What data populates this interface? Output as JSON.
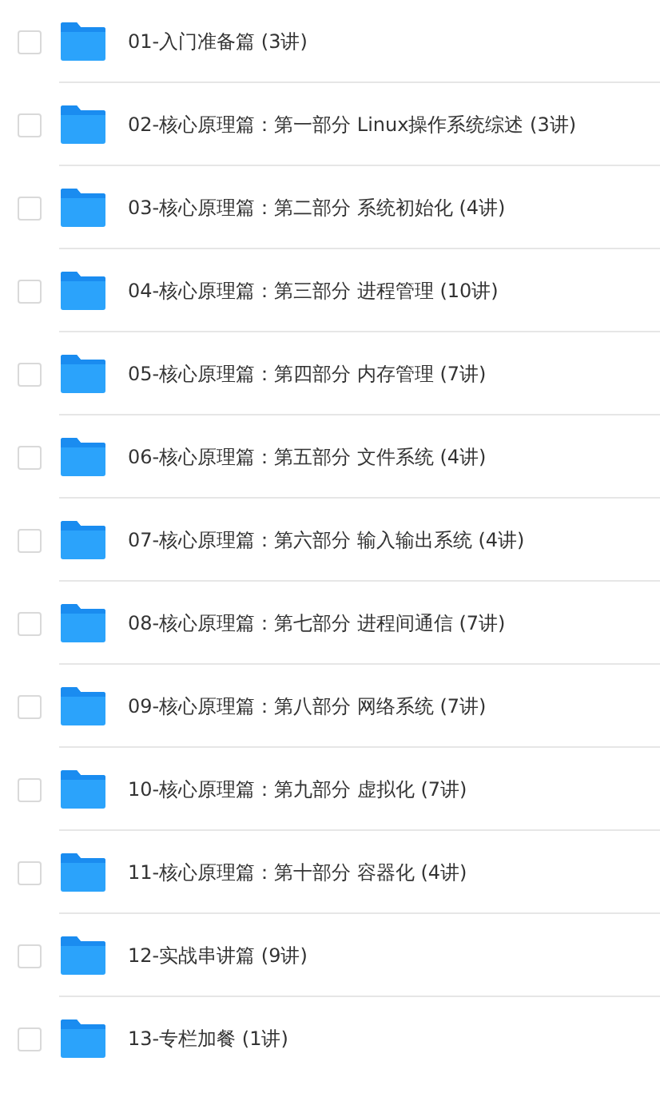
{
  "items": [
    {
      "title": "01-入门准备篇 (3讲)",
      "checked": false
    },
    {
      "title": "02-核心原理篇：第一部分 Linux操作系统综述 (3讲)",
      "checked": false
    },
    {
      "title": "03-核心原理篇：第二部分 系统初始化 (4讲)",
      "checked": false
    },
    {
      "title": "04-核心原理篇：第三部分 进程管理 (10讲)",
      "checked": false
    },
    {
      "title": "05-核心原理篇：第四部分 内存管理 (7讲)",
      "checked": false
    },
    {
      "title": "06-核心原理篇：第五部分 文件系统 (4讲)",
      "checked": false
    },
    {
      "title": "07-核心原理篇：第六部分 输入输出系统 (4讲)",
      "checked": false
    },
    {
      "title": "08-核心原理篇：第七部分 进程间通信 (7讲)",
      "checked": false
    },
    {
      "title": "09-核心原理篇：第八部分 网络系统 (7讲)",
      "checked": false
    },
    {
      "title": "10-核心原理篇：第九部分 虚拟化 (7讲)",
      "checked": false
    },
    {
      "title": "11-核心原理篇：第十部分 容器化 (4讲)",
      "checked": false
    },
    {
      "title": "12-实战串讲篇 (9讲)",
      "checked": false
    },
    {
      "title": "13-专栏加餐 (1讲)",
      "checked": false
    }
  ]
}
